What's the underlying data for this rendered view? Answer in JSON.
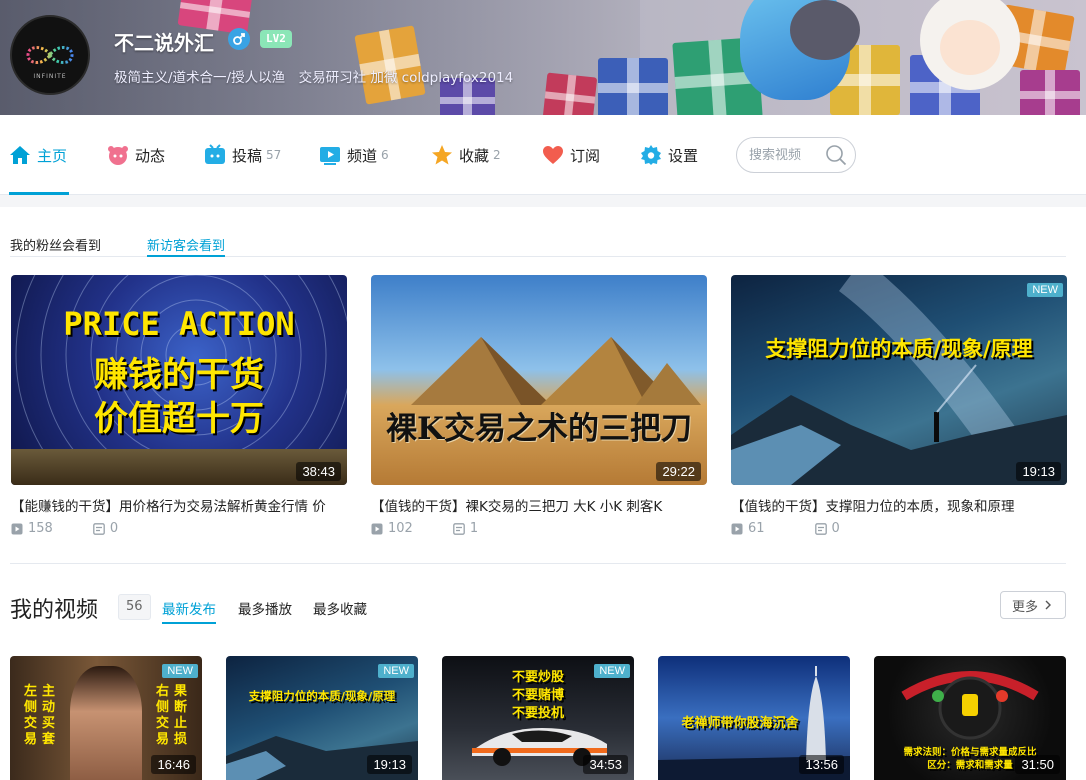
{
  "profile": {
    "username": "不二说外汇",
    "level": "LV2",
    "signature": "极简主义/道术合一/授人以渔　交易研习社 加微 coldplayfox2014"
  },
  "nav": {
    "items": [
      {
        "label": "主页",
        "count": ""
      },
      {
        "label": "动态",
        "count": ""
      },
      {
        "label": "投稿",
        "count": "57"
      },
      {
        "label": "频道",
        "count": "6"
      },
      {
        "label": "收藏",
        "count": "2"
      },
      {
        "label": "订阅",
        "count": ""
      },
      {
        "label": "设置",
        "count": ""
      }
    ],
    "search_placeholder": "搜索视频"
  },
  "featured": {
    "tabs": [
      "我的粉丝会看到",
      "新访客会看到"
    ],
    "videos": [
      {
        "thumb_lines": [
          "PRICE ACTION",
          "赚钱的干货",
          "价值超十万"
        ],
        "duration": "38:43",
        "title": "【能赚钱的干货】用价格行为交易法解析黄金行情 价",
        "plays": "158",
        "comments": "0"
      },
      {
        "thumb_lines": [
          "裸K交易之术的三把刀"
        ],
        "duration": "29:22",
        "title": "【值钱的干货】裸K交易的三把刀 大K 小K 刺客K",
        "plays": "102",
        "comments": "1"
      },
      {
        "thumb_lines": [
          "支撑阻力位的本质/现象/原理"
        ],
        "badge": "NEW",
        "duration": "19:13",
        "title": "【值钱的干货】支撑阻力位的本质，现象和原理",
        "plays": "61",
        "comments": "0"
      }
    ]
  },
  "my_videos": {
    "title": "我的视频",
    "count": "56",
    "tabs": [
      "最新发布",
      "最多播放",
      "最多收藏"
    ],
    "more_label": "更多",
    "videos": [
      {
        "badge": "NEW",
        "duration": "16:46",
        "left_text": "左侧交易",
        "left_text2": "主动买套",
        "right_text": "右侧交易",
        "right_text2": "果断止损"
      },
      {
        "badge": "NEW",
        "duration": "19:13",
        "thumb_text": "支撑阻力位的本质/现象/原理"
      },
      {
        "badge": "NEW",
        "duration": "34:53",
        "thumb_lines": [
          "不要炒股",
          "不要赌博",
          "不要投机"
        ]
      },
      {
        "duration": "13:56",
        "thumb_text": "老禅师带你股海沉舍"
      },
      {
        "duration": "31:50",
        "thumb_lines": [
          "需求法则：价格与需求量成反比",
          "区分：需求和需求量"
        ]
      }
    ]
  },
  "colors": {
    "accent": "#00a1d6",
    "new_badge": "#4eb0cc",
    "muted": "#99a2aa"
  }
}
